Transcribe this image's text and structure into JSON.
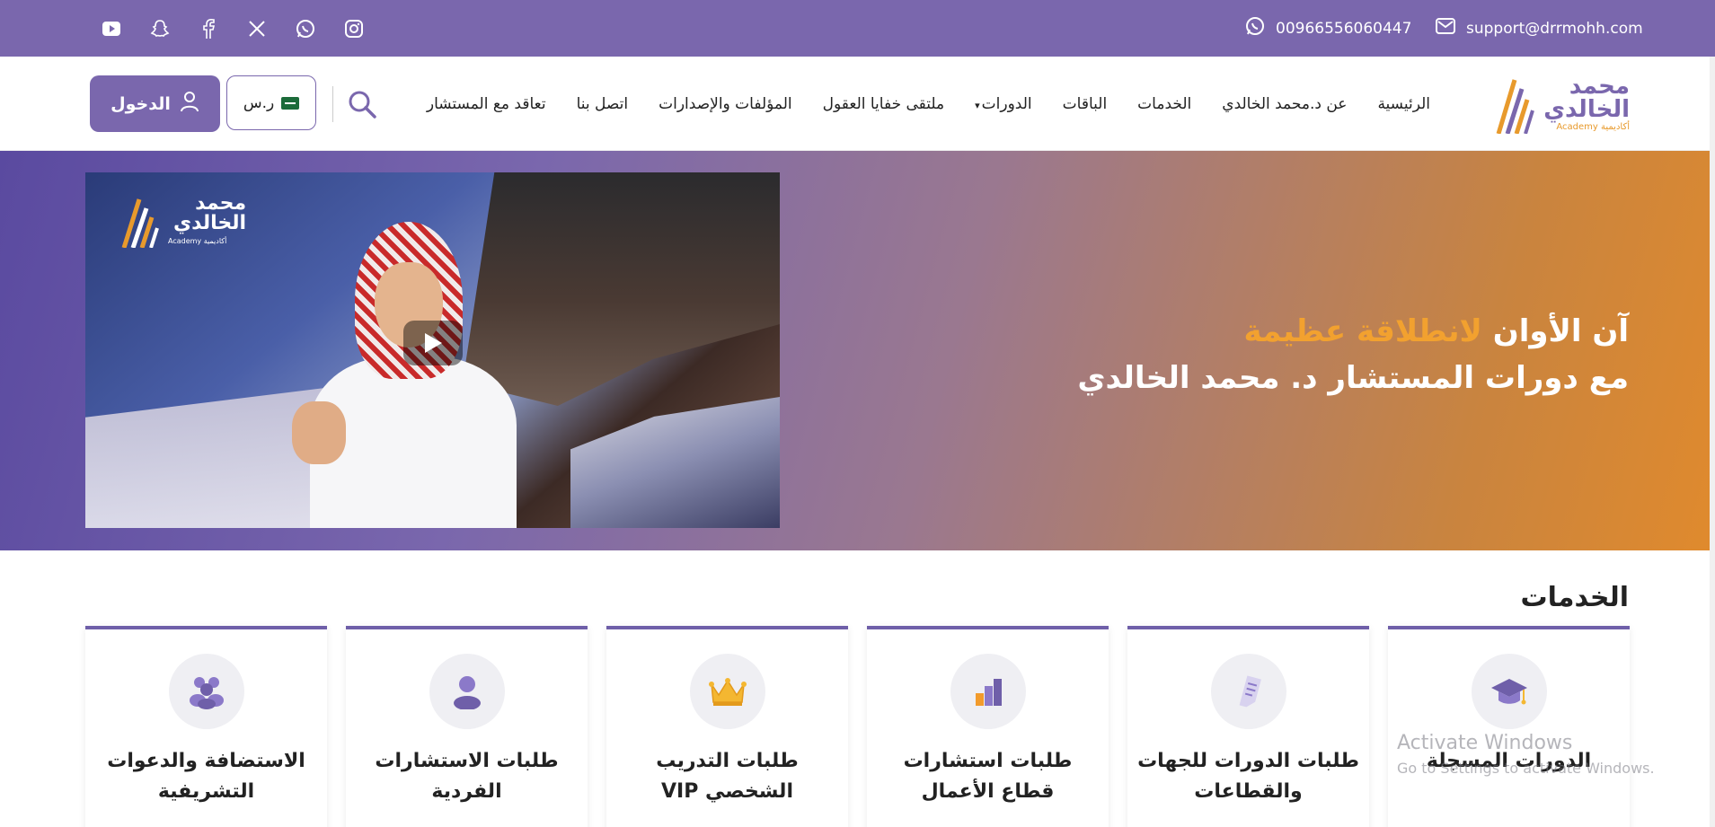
{
  "topbar": {
    "email": "support@drrmohh.com",
    "phone": "00966556060447",
    "social": [
      "instagram-icon",
      "whatsapp-icon",
      "x-icon",
      "facebook-icon",
      "snapchat-icon",
      "youtube-icon"
    ]
  },
  "logo": {
    "text_line1": "محمد",
    "text_line2": "الخالدي",
    "sub": "Academy أكاديمية"
  },
  "nav": {
    "items": [
      "الرئيسية",
      "عن د.محمد الخالدي",
      "الخدمات",
      "الباقات",
      "الدورات",
      "ملتقى خفايا العقول",
      "المؤلفات والإصدارات",
      "اتصل بنا",
      "تعاقد مع المستشار"
    ],
    "currency": "ر.س",
    "login": "الدخول"
  },
  "hero": {
    "line1_plain": "آن الأوان",
    "line1_accent": "لانطلاقة عظيمة",
    "line2": "مع دورات المستشار د. محمد الخالدي",
    "video_logo_line1": "محمد",
    "video_logo_line2": "الخالدي",
    "video_logo_sub": "Academy أكاديمية"
  },
  "services": {
    "title": "الخدمات",
    "cards": [
      {
        "label": "الدورات المسجلة",
        "icon": "graduation-cap-icon"
      },
      {
        "label": "طلبات الدورات للجهات والقطاعات",
        "icon": "document-icon"
      },
      {
        "label": "طلبات استشارات قطاع الأعمال",
        "icon": "bar-chart-icon"
      },
      {
        "label": "طلبات التدريب الشخصي VIP",
        "icon": "crown-icon"
      },
      {
        "label": "طلبات الاستشارات الفردية",
        "icon": "person-icon"
      },
      {
        "label": "الاستضافة والدعوات التشريفية",
        "icon": "group-icon"
      }
    ]
  },
  "watermark": {
    "line1": "Activate Windows",
    "line2": "Go to Settings to activate Windows."
  },
  "colors": {
    "brand_purple": "#7a67ad",
    "brand_orange": "#f2a12f"
  }
}
